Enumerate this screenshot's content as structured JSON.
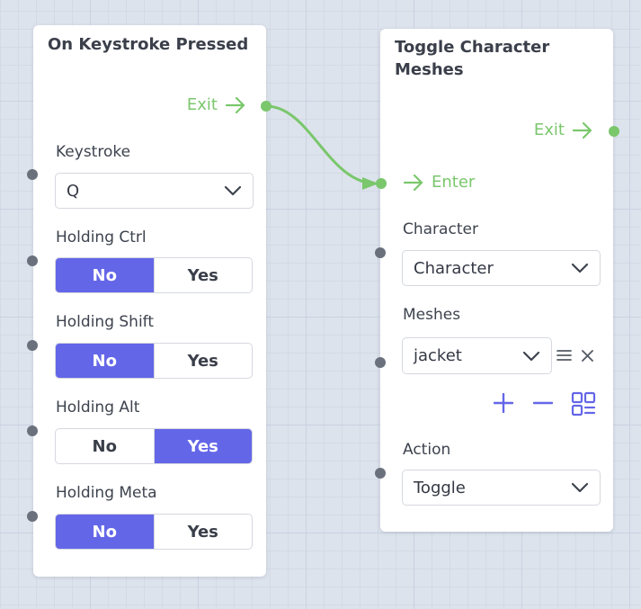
{
  "nodes": {
    "keystroke": {
      "title": "On Keystroke Pressed",
      "exit_label": "Exit",
      "keystroke": {
        "label": "Keystroke",
        "value": "Q"
      },
      "toggles": [
        {
          "label": "Holding Ctrl",
          "no": "No",
          "yes": "Yes",
          "selected": "No"
        },
        {
          "label": "Holding Shift",
          "no": "No",
          "yes": "Yes",
          "selected": "No"
        },
        {
          "label": "Holding Alt",
          "no": "No",
          "yes": "Yes",
          "selected": "Yes"
        },
        {
          "label": "Holding Meta",
          "no": "No",
          "yes": "Yes",
          "selected": "No"
        }
      ]
    },
    "toggle_meshes": {
      "title_line1": "Toggle Character",
      "title_line2": "Meshes",
      "exit_label": "Exit",
      "enter_label": "Enter",
      "character": {
        "label": "Character",
        "value": "Character"
      },
      "meshes": {
        "label": "Meshes",
        "item": "jacket"
      },
      "action": {
        "label": "Action",
        "value": "Toggle"
      }
    }
  },
  "icons": {
    "arrow": "arrow-right-icon",
    "chevron": "chevron-down-icon",
    "drag": "drag-handle-icon",
    "close": "close-icon",
    "add": "plus-icon",
    "remove": "minus-icon",
    "grid": "grid-icon"
  },
  "colors": {
    "accent": "#6466e8",
    "flow": "#7ac76c",
    "port": "#6b717c"
  }
}
